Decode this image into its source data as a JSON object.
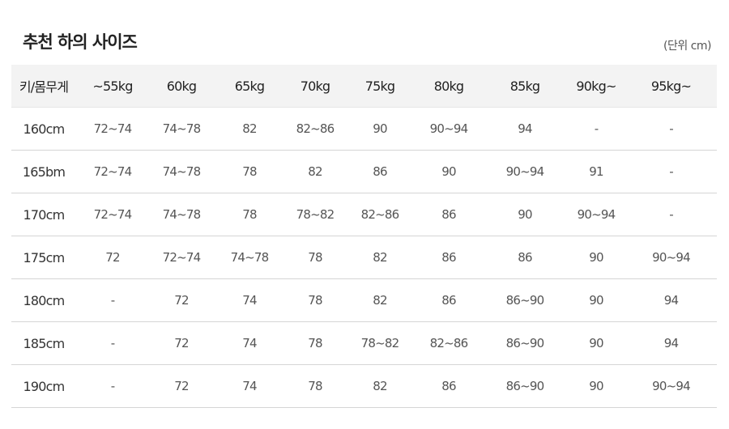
{
  "title": "추천 하의 사이즈",
  "unit_note": "(단위 cm)",
  "table": {
    "headers": [
      "키/몸무게",
      "~55kg",
      "60kg",
      "65kg",
      "70kg",
      "75kg",
      "80kg",
      "85kg",
      "90kg~",
      "95kg~"
    ],
    "rows": [
      [
        "160cm",
        "72~74",
        "74~78",
        "82",
        "82~86",
        "90",
        "90~94",
        "94",
        "-",
        "-"
      ],
      [
        "165bm",
        "72~74",
        "74~78",
        "78",
        "82",
        "86",
        "90",
        "90~94",
        "91",
        "-"
      ],
      [
        "170cm",
        "72~74",
        "74~78",
        "78",
        "78~82",
        "82~86",
        "86",
        "90",
        "90~94",
        "-"
      ],
      [
        "175cm",
        "72",
        "72~74",
        "74~78",
        "78",
        "82",
        "86",
        "86",
        "90",
        "90~94"
      ],
      [
        "180cm",
        "-",
        "72",
        "74",
        "78",
        "82",
        "86",
        "86~90",
        "90",
        "94"
      ],
      [
        "185cm",
        "-",
        "72",
        "74",
        "78",
        "78~82",
        "82~86",
        "86~90",
        "90",
        "94"
      ],
      [
        "190cm",
        "-",
        "72",
        "74",
        "78",
        "82",
        "86",
        "86~90",
        "90",
        "90~94"
      ]
    ]
  }
}
